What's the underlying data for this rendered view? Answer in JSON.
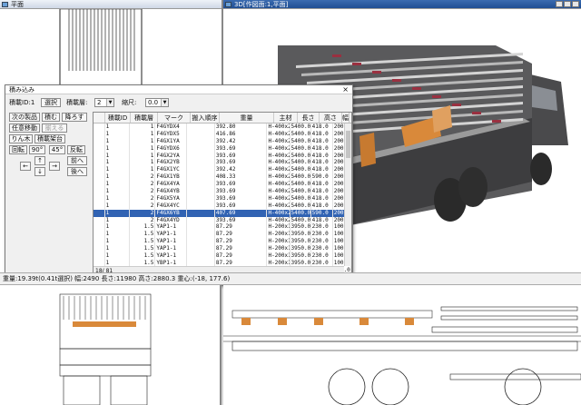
{
  "windows": {
    "plan_title": "平面",
    "view3d_title": "3D[作図面:1,平面]"
  },
  "dialog": {
    "title": "積み込み",
    "close": "×",
    "load_id_label": "積載ID:1",
    "select_button": "選択",
    "layer_label": "積載層:",
    "layer_value": "2",
    "scale_label": "縮尺:",
    "scale_value": "0.0",
    "buttons": {
      "next_product": "次の製品",
      "stack": "積む",
      "unload": "降ろす",
      "move_all": "任意移動",
      "align": "揃える",
      "ringwood": "りん木",
      "load_stand": "積載架台",
      "rotate": "回転",
      "deg90": "90°",
      "deg45": "45°",
      "flip": "反転",
      "up": "↑",
      "down": "↓",
      "left": "←",
      "right": "→",
      "forward": "前へ",
      "backward": "後へ"
    },
    "columns": [
      "",
      "積載ID",
      "積載層",
      "マーク",
      "搬入順序",
      "重量",
      "主材",
      "長さ",
      "高さ",
      "幅"
    ],
    "rows": [
      [
        "",
        "1",
        "1",
        "F4GYDX4",
        "",
        "392.80",
        "H-400x200x8x12",
        "5400.0",
        "418.0",
        "200.0"
      ],
      [
        "",
        "1",
        "1",
        "F4GYDX5",
        "",
        "416.86",
        "H-400x200x8x12",
        "5400.0",
        "418.0",
        "200.0"
      ],
      [
        "",
        "1",
        "1",
        "F4GX1YA",
        "",
        "392.42",
        "H-400x200x8x12",
        "5400.0",
        "418.0",
        "200.0"
      ],
      [
        "",
        "1",
        "1",
        "F4GYDX6",
        "",
        "393.69",
        "H-400x200x8x12",
        "5400.0",
        "418.0",
        "200.0"
      ],
      [
        "",
        "1",
        "1",
        "F4GX2YA",
        "",
        "393.69",
        "H-400x200x8x12",
        "5400.0",
        "418.0",
        "200.0"
      ],
      [
        "",
        "1",
        "1",
        "F4GX2YB",
        "",
        "393.69",
        "H-400x200x8x12",
        "5400.0",
        "418.0",
        "200.0"
      ],
      [
        "",
        "1",
        "1",
        "F4GX1YC",
        "",
        "392.42",
        "H-400x200x8x12",
        "5400.0",
        "418.0",
        "200.0"
      ],
      [
        "",
        "1",
        "2",
        "F4GX1YB",
        "",
        "408.33",
        "H-400x200x8x12",
        "5400.0",
        "590.0",
        "200.0"
      ],
      [
        "",
        "1",
        "2",
        "F4GX4YA",
        "",
        "393.69",
        "H-400x200x8x12",
        "5400.0",
        "418.0",
        "200.0"
      ],
      [
        "",
        "1",
        "2",
        "F4GX4YB",
        "",
        "393.69",
        "H-400x200x8x12",
        "5400.0",
        "418.0",
        "200.0"
      ],
      [
        "",
        "1",
        "2",
        "F4GX5YA",
        "",
        "393.69",
        "H-400x200x8x12",
        "5400.0",
        "418.0",
        "200.0"
      ],
      [
        "",
        "1",
        "2",
        "F4GX4YC",
        "",
        "393.69",
        "H-400x200x8x12",
        "5400.0",
        "418.0",
        "200.0"
      ],
      [
        "",
        "1",
        "2",
        "F4GX6YB",
        "",
        "407.69",
        "H-400x200x8x12",
        "5400.0",
        "590.0",
        "200.0"
      ],
      [
        "",
        "1",
        "2",
        "F4GX4YD",
        "",
        "393.69",
        "H-400x200x8x12",
        "5400.0",
        "418.0",
        "200.0"
      ],
      [
        "",
        "1",
        "1.5",
        "YAP1-1",
        "",
        "87.29",
        "H-200x100x5.5x8",
        "3950.0",
        "230.0",
        "100.0"
      ],
      [
        "",
        "1",
        "1.5",
        "YAP1-1",
        "",
        "87.29",
        "H-200x100x5.5x8",
        "3950.0",
        "230.0",
        "100.0"
      ],
      [
        "",
        "1",
        "1.5",
        "YAP1-1",
        "",
        "87.29",
        "H-200x100x5.5x8",
        "3950.0",
        "230.0",
        "100.0"
      ],
      [
        "",
        "1",
        "1.5",
        "YAP1-1",
        "",
        "87.29",
        "H-200x100x5.5x8",
        "3950.0",
        "230.0",
        "100.0"
      ],
      [
        "",
        "1",
        "1.5",
        "YAP1-1",
        "",
        "87.29",
        "H-200x100x5.5x8",
        "3950.0",
        "230.0",
        "100.0"
      ],
      [
        "",
        "1",
        "1.5",
        "YBP1-1",
        "",
        "87.29",
        "H-200x100x5.5x8",
        "3950.0",
        "230.0",
        "100.0"
      ],
      [
        "",
        "1",
        "1.5",
        "YDP1-1",
        "",
        "87.29",
        "H-200x100x5.5x8",
        "3950.0",
        "230.0",
        "100.0"
      ]
    ],
    "selected_row": 12,
    "pager": "18/ 81"
  },
  "status": {
    "text": "重量:19.39t(0.41t選択) 幅:2490 長さ:11980 高さ:2880.3 重心:(-18, 177.6)"
  },
  "colors": {
    "selection": "#3163b3",
    "beam_orange": "#d9893a",
    "beam_red": "#9a3040"
  }
}
